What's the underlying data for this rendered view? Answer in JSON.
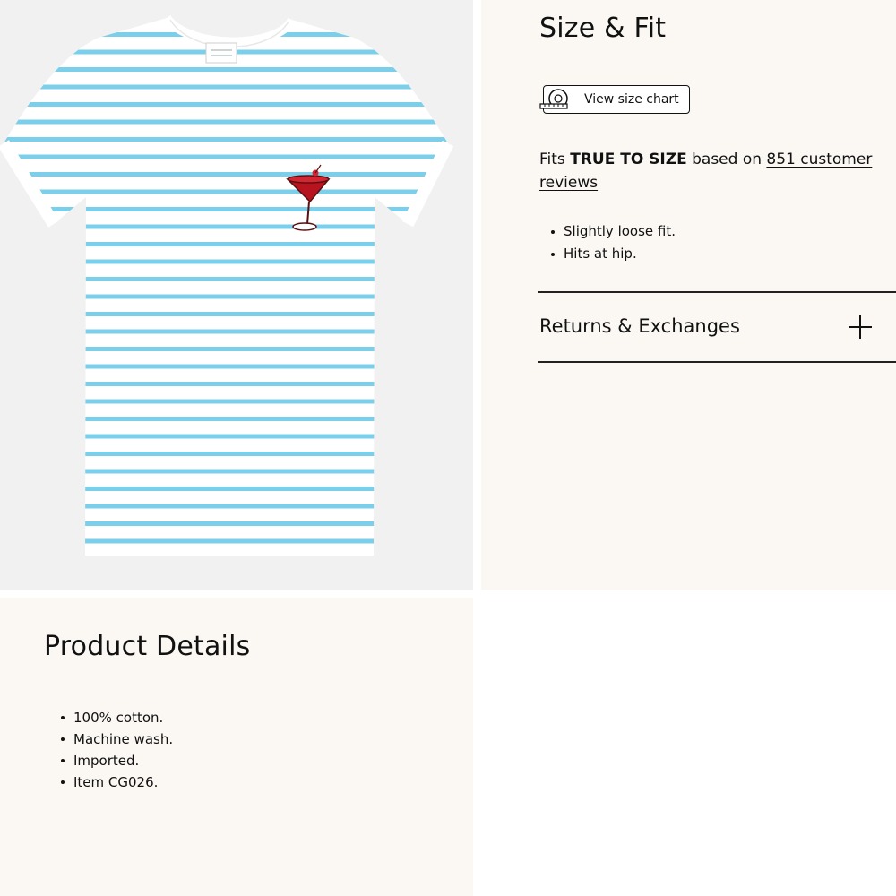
{
  "product_image": {
    "alt": "Striped t-shirt with martini glass graphic",
    "stripe_color": "#7ccfea",
    "garment_color": "#ffffff",
    "backdrop_color": "#f1f1f1",
    "graphic_icon": "martini-glass-icon",
    "graphic_color": "#b7141f"
  },
  "size_fit": {
    "title": "Size & Fit",
    "size_chart_button_label": "View size chart",
    "size_chart_icon": "measuring-tape-icon",
    "fit_prefix": "Fits ",
    "fit_strong": "TRUE TO SIZE",
    "fit_middle": " based on ",
    "reviews_link": "851 customer reviews",
    "bullets": [
      "Slightly loose fit.",
      "Hits at hip."
    ]
  },
  "returns": {
    "label": "Returns & Exchanges",
    "expand_icon": "plus-icon"
  },
  "product_details": {
    "title": "Product Details",
    "bullets": [
      "100% cotton.",
      "Machine wash.",
      "Imported.",
      "Item CG026."
    ]
  },
  "colors": {
    "panel_background": "#fbf8f4",
    "text": "#111111"
  }
}
